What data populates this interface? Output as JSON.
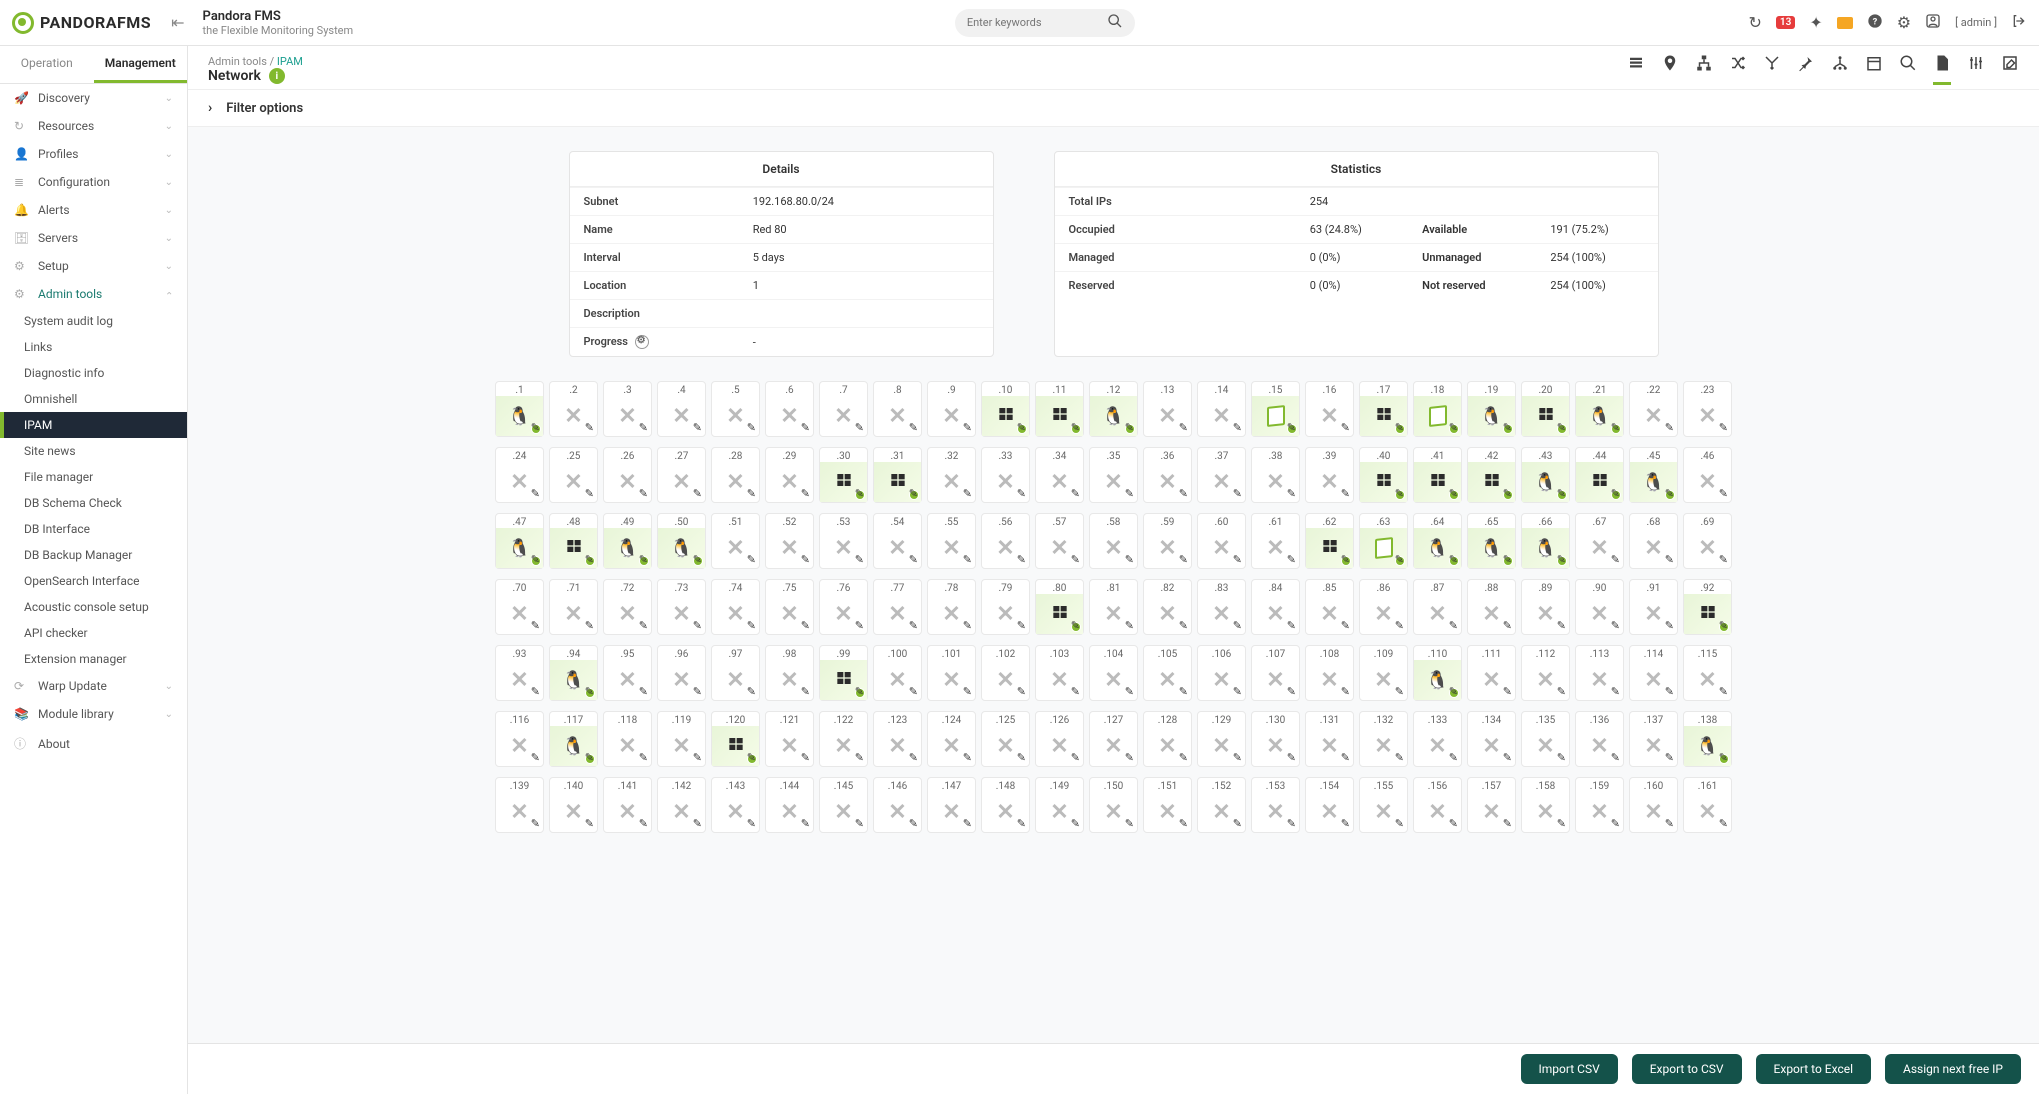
{
  "brand": "PANDORAFMS",
  "header": {
    "title": "Pandora FMS",
    "subtitle": "the Flexible Monitoring System",
    "search_placeholder": "Enter keywords",
    "badge_count": "13",
    "user_label": "[ admin ]"
  },
  "sidebar": {
    "tabs": {
      "operation": "Operation",
      "management": "Management"
    },
    "menu": [
      {
        "label": "Discovery",
        "icon": "rocket"
      },
      {
        "label": "Resources",
        "icon": "refresh"
      },
      {
        "label": "Profiles",
        "icon": "user"
      },
      {
        "label": "Configuration",
        "icon": "layers"
      },
      {
        "label": "Alerts",
        "icon": "bell"
      },
      {
        "label": "Servers",
        "icon": "server"
      },
      {
        "label": "Setup",
        "icon": "gear"
      }
    ],
    "admin_tools": {
      "label": "Admin tools",
      "items": [
        "System audit log",
        "Links",
        "Diagnostic info",
        "Omnishell",
        "IPAM",
        "Site news",
        "File manager",
        "DB Schema Check",
        "DB Interface",
        "DB Backup Manager",
        "OpenSearch Interface",
        "Acoustic console setup",
        "API checker",
        "Extension manager"
      ],
      "active": "IPAM"
    },
    "tail": [
      {
        "label": "Warp Update",
        "icon": "warp"
      },
      {
        "label": "Module library",
        "icon": "library"
      },
      {
        "label": "About",
        "icon": "info"
      }
    ]
  },
  "breadcrumb": {
    "path_prefix": "Admin tools /",
    "path_current": "IPAM",
    "title": "Network"
  },
  "filter_label": "Filter options",
  "details": {
    "title": "Details",
    "rows": {
      "Subnet": "192.168.80.0/24",
      "Name": "Red 80",
      "Interval": "5 days",
      "Location": "1",
      "Description": "",
      "Progress": "-"
    }
  },
  "statistics": {
    "title": "Statistics",
    "rows": [
      {
        "k": "Total IPs",
        "v": "254"
      },
      {
        "k": "Occupied",
        "v": "63 (24.8%)",
        "k2": "Available",
        "v2": "191 (75.2%)"
      },
      {
        "k": "Managed",
        "v": "0 (0%)",
        "k2": "Unmanaged",
        "v2": "254 (100%)"
      },
      {
        "k": "Reserved",
        "v": "0 (0%)",
        "k2": "Not reserved",
        "v2": "254 (100%)"
      }
    ]
  },
  "buttons": {
    "import_csv": "Import CSV",
    "export_csv": "Export to CSV",
    "export_excel": "Export to Excel",
    "assign_ip": "Assign next free IP"
  },
  "ip_grid": {
    "per_row": 23,
    "rows": 7,
    "start": 1,
    "alive": {
      "1": "tux",
      "10": "win",
      "11": "win",
      "12": "tux",
      "15": "box",
      "17": "win",
      "18": "box",
      "19": "tux",
      "20": "win",
      "21": "tux",
      "30": "win",
      "31": "win",
      "40": "win",
      "41": "win",
      "42": "win",
      "43": "tux",
      "44": "win",
      "45": "tux",
      "47": "tux",
      "48": "win",
      "49": "tux",
      "50": "tux",
      "62": "win",
      "63": "box",
      "64": "tux",
      "65": "tux",
      "66": "tux",
      "80": "win",
      "92": "win",
      "94": "tux",
      "99": "win",
      "110": "tux",
      "117": "tux",
      "120": "win",
      "138": "tux"
    }
  }
}
